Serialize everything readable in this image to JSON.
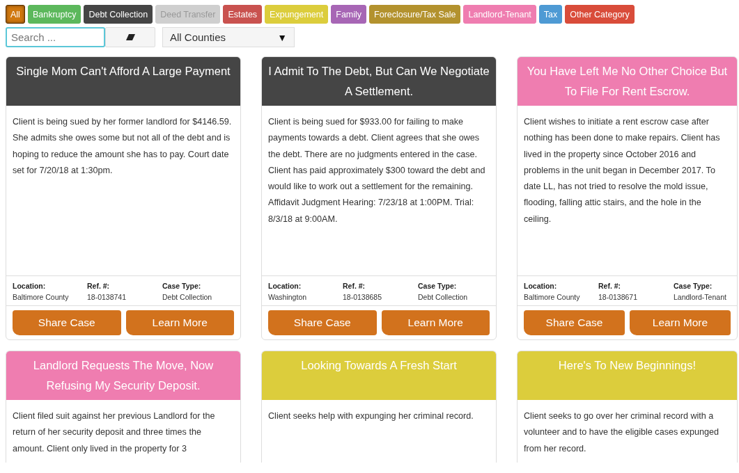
{
  "categories": [
    {
      "label": "All",
      "color": "#d0780f",
      "selected": true
    },
    {
      "label": "Bankruptcy",
      "color": "#5cb85c",
      "selected": false
    },
    {
      "label": "Debt Collection",
      "color": "#454545",
      "selected": false
    },
    {
      "label": "Deed Transfer",
      "color": "#cfcfcf",
      "selected": false
    },
    {
      "label": "Estates",
      "color": "#c9524f",
      "selected": false
    },
    {
      "label": "Expungement",
      "color": "#dccd3c",
      "selected": false
    },
    {
      "label": "Family",
      "color": "#a766b5",
      "selected": false
    },
    {
      "label": "Foreclosure/Tax Sale",
      "color": "#b3922e",
      "selected": false
    },
    {
      "label": "Landlord-Tenant",
      "color": "#ef7db0",
      "selected": false
    },
    {
      "label": "Tax",
      "color": "#4e9ad4",
      "selected": false
    },
    {
      "label": "Other Category",
      "color": "#d94c3a",
      "selected": false
    }
  ],
  "search": {
    "placeholder": "Search ..."
  },
  "county_select": {
    "value": "All Counties",
    "arrow": "▼"
  },
  "cases": [
    {
      "title": "Single Mom Can't Afford A Large Payment",
      "color": "#454545",
      "body": "Client is being sued by her former landlord for $4146.59. She admits she owes some but not all of the debt and is hoping to reduce the amount she has to pay. Court date set for 7/20/18 at 1:30pm.",
      "details": [
        {
          "label": "Location:",
          "value": "Baltimore County"
        },
        {
          "label": "Ref. #:",
          "value": "18-0138741"
        },
        {
          "label": "Case Type:",
          "value": "Debt Collection"
        }
      ],
      "buttons": [
        "Share Case",
        "Learn More"
      ]
    },
    {
      "title": "I Admit To The Debt, But Can We Negotiate A Settlement.",
      "color": "#454545",
      "body": "Client is being sued for $933.00 for failing to make payments towards a debt. Client agrees that she owes the debt. There are no judgments entered in the case. Client has paid approximately $300 toward the debt and would like to work out a settlement for the remaining. Affidavit Judgment Hearing: 7/23/18 at 1:00PM. Trial: 8/3/18 at 9:00AM.",
      "details": [
        {
          "label": "Location:",
          "value": "Washington"
        },
        {
          "label": "Ref. #:",
          "value": "18-0138685"
        },
        {
          "label": "Case Type:",
          "value": "Debt Collection"
        }
      ],
      "buttons": [
        "Share Case",
        "Learn More"
      ]
    },
    {
      "title": "You Have Left Me No Other Choice But To File For Rent Escrow.",
      "color": "#ef7db0",
      "body": "Client wishes to initiate a rent escrow case after nothing has been done to make repairs. Client has lived in the property since October 2016 and problems in the unit began in December 2017. To date LL, has not tried to resolve the mold issue, flooding, falling attic stairs, and the hole in the ceiling.",
      "details": [
        {
          "label": "Location:",
          "value": "Baltimore County"
        },
        {
          "label": "Ref. #:",
          "value": "18-0138671"
        },
        {
          "label": "Case Type:",
          "value": "Landlord-Tenant"
        }
      ],
      "buttons": [
        "Share Case",
        "Learn More"
      ]
    },
    {
      "title": "Landlord Requests The Move, Now Refusing My Security Deposit.",
      "color": "#ef7db0",
      "body": "Client filed suit against her previous Landlord for the return of her security deposit and three times the amount. Client only lived in the property for 3"
    },
    {
      "title": "Looking Towards A Fresh Start",
      "color": "#dccd3c",
      "body": "Client seeks help with expunging her criminal record."
    },
    {
      "title": "Here's To New Beginnings!",
      "color": "#dccd3c",
      "body": "Client seeks to go over her criminal record with a volunteer and to have the eligible cases expunged from her record."
    }
  ]
}
